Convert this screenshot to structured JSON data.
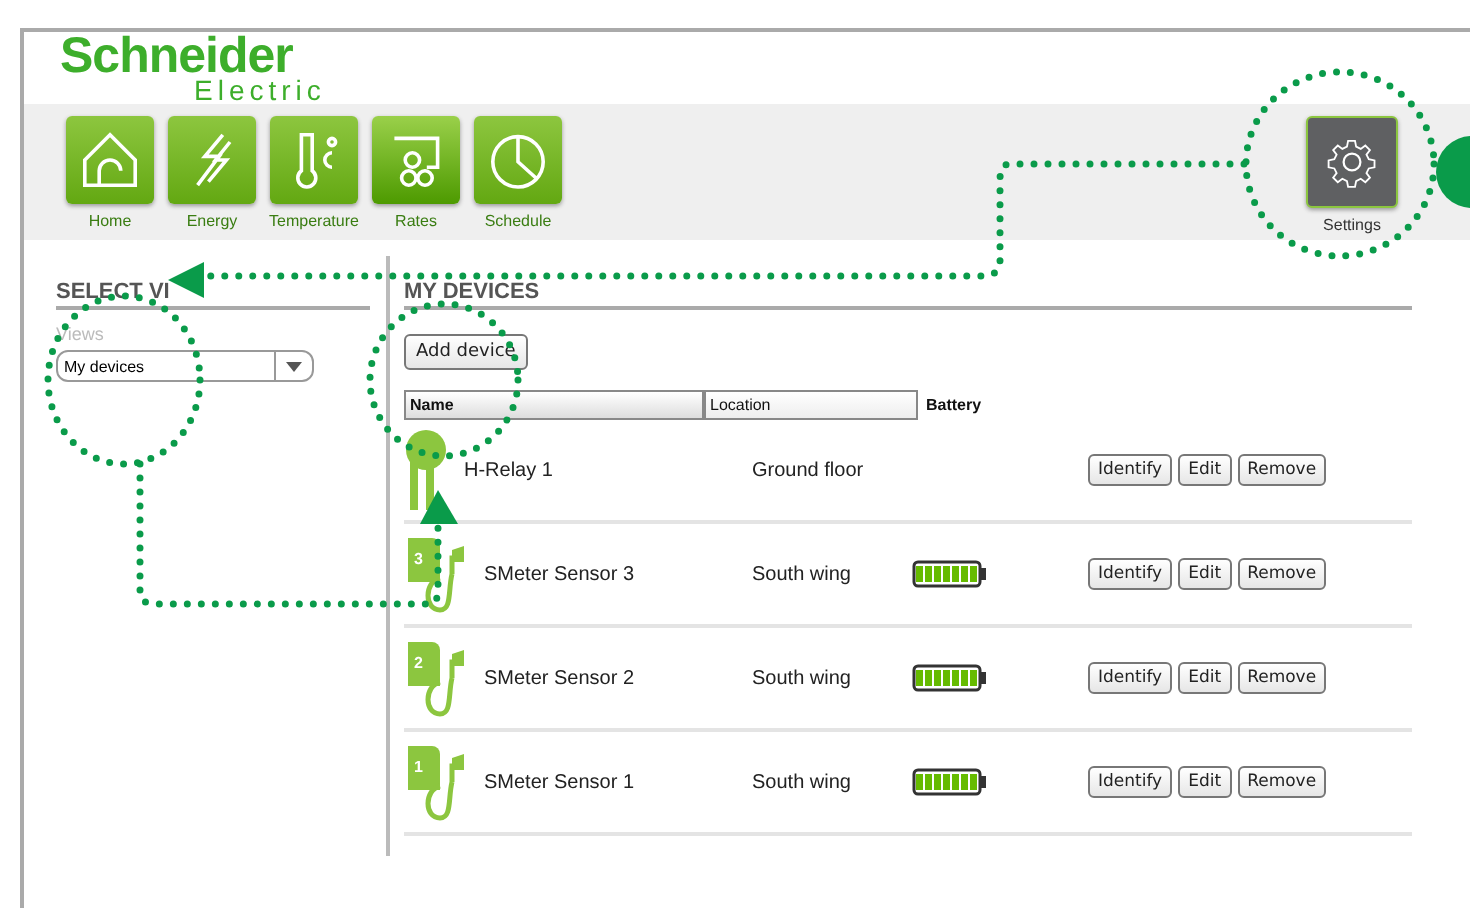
{
  "logo": {
    "name": "Schneider",
    "sub": "Electric"
  },
  "nav": [
    {
      "label": "Home",
      "kind": "home",
      "selected": false
    },
    {
      "label": "Energy",
      "kind": "energy",
      "selected": false
    },
    {
      "label": "Temperature",
      "kind": "temperature",
      "selected": false
    },
    {
      "label": "Rates",
      "kind": "rates",
      "selected": true
    },
    {
      "label": "Schedule",
      "kind": "schedule",
      "selected": false
    }
  ],
  "settings": {
    "label": "Settings"
  },
  "sidebar": {
    "heading": "SELECT VI",
    "views_label": "Views",
    "views_value": "My devices"
  },
  "main": {
    "heading": "MY DEVICES",
    "add_button": "Add device",
    "columns": [
      "Name",
      "Location",
      "Battery"
    ],
    "rows": [
      {
        "kind": "relay",
        "name": "H-Relay 1",
        "location": "Ground floor",
        "battery": false,
        "actions": [
          "Identify",
          "Edit",
          "Remove"
        ]
      },
      {
        "kind": "sensor",
        "badge": "3",
        "name": "SMeter Sensor 3",
        "location": "South wing",
        "battery": true,
        "actions": [
          "Identify",
          "Edit",
          "Remove"
        ]
      },
      {
        "kind": "sensor",
        "badge": "2",
        "name": "SMeter Sensor 2",
        "location": "South wing",
        "battery": true,
        "actions": [
          "Identify",
          "Edit",
          "Remove"
        ]
      },
      {
        "kind": "sensor",
        "badge": "1",
        "name": "SMeter Sensor 1",
        "location": "South wing",
        "battery": true,
        "actions": [
          "Identify",
          "Edit",
          "Remove"
        ]
      }
    ]
  }
}
